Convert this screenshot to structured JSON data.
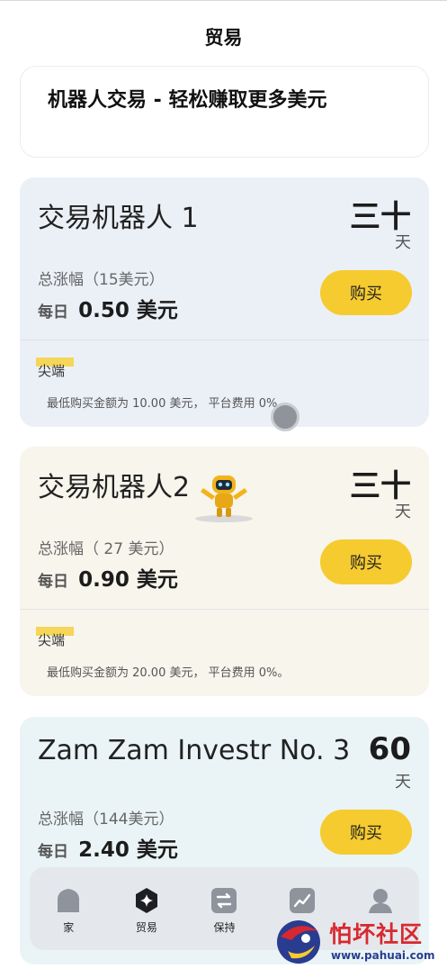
{
  "header": {
    "title": "贸易"
  },
  "banner": {
    "text": "机器人交易 - 轻松赚取更多美元"
  },
  "bots": [
    {
      "name": "交易机器人 1",
      "days": "三十",
      "days_unit": "天",
      "total_label": "总涨幅（15美元）",
      "daily_label": "每日",
      "daily_value": "0.50 美元",
      "buy_label": "购买",
      "tag": "尖端",
      "note": "最低购买金额为 10.00 美元， 平台费用 0%。",
      "bg_color": "#ebf0f7"
    },
    {
      "name": "交易机器人2",
      "days": "三十",
      "days_unit": "天",
      "total_label": "总涨幅（ 27 美元）",
      "daily_label": "每日",
      "daily_value": "0.90 美元",
      "buy_label": "购买",
      "tag": "尖端",
      "note": "最低购买金额为 20.00 美元， 平台费用 0%。",
      "bg_color": "#f7f5ec"
    },
    {
      "name": "Zam Zam Investr No. 3",
      "days": "60",
      "days_unit": "天",
      "total_label": "总涨幅（144美元）",
      "daily_label": "每日",
      "daily_value": "2.40 美元",
      "buy_label": "购买",
      "bg_color": "#eaf4f6"
    }
  ],
  "nav": {
    "items": [
      {
        "label": "家",
        "icon": "home-icon"
      },
      {
        "label": "贸易",
        "icon": "trade-icon"
      },
      {
        "label": "保持",
        "icon": "exchange-icon"
      },
      {
        "label": "",
        "icon": "chart-icon"
      },
      {
        "label": "",
        "icon": "profile-icon"
      }
    ]
  },
  "watermark": {
    "title": "怕坏社区",
    "url": "www.pahuai.com"
  },
  "colors": {
    "accent": "#f6cb2f",
    "icon_gray": "#8e939c",
    "watermark_red": "#d8282f"
  }
}
